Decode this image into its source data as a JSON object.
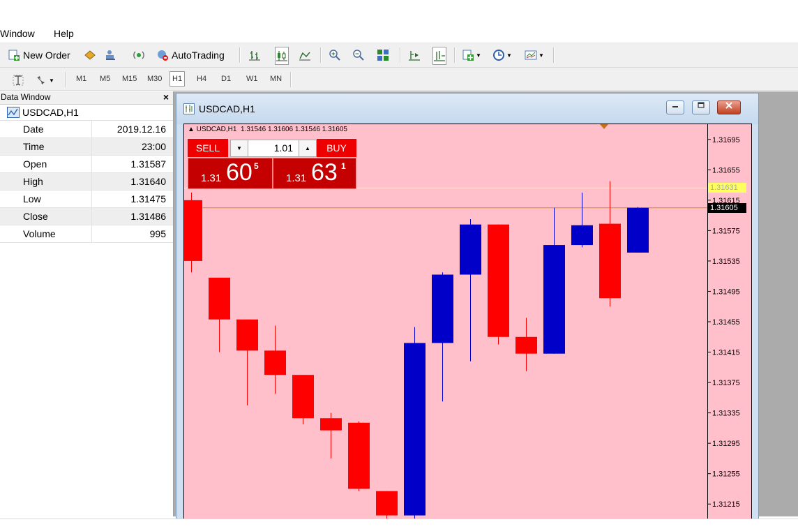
{
  "menu": [
    "Window",
    "Help"
  ],
  "toolbar": {
    "new_order": "New Order",
    "auto_trading": "AutoTrading"
  },
  "timeframes": [
    "M1",
    "M5",
    "M15",
    "M30",
    "H1",
    "H4",
    "D1",
    "W1",
    "MN"
  ],
  "active_timeframe": "H1",
  "data_window": {
    "title": "Data Window",
    "close_glyph": "×",
    "symbol": "USDCAD,H1",
    "rows": [
      {
        "key": "Date",
        "value": "2019.12.16"
      },
      {
        "key": "Time",
        "value": "23:00"
      },
      {
        "key": "Open",
        "value": "1.31587"
      },
      {
        "key": "High",
        "value": "1.31640"
      },
      {
        "key": "Low",
        "value": "1.31475"
      },
      {
        "key": "Close",
        "value": "1.31486"
      },
      {
        "key": "Volume",
        "value": "995"
      }
    ]
  },
  "chart_window": {
    "title": "USDCAD,H1",
    "info_line": "▲ USDCAD,H1  1.31546 1.31606 1.31546 1.31605",
    "sell_label": "SELL",
    "buy_label": "BUY",
    "lot_size": "1.01",
    "sell_price": {
      "prefix": "1.31",
      "big": "60",
      "sup": "5"
    },
    "buy_price": {
      "prefix": "1.31",
      "big": "63",
      "sup": "1"
    },
    "price_tag_current": "1.31605",
    "price_tag_yellow": "1.31631",
    "price_labels": [
      "1.31695",
      "1.31655",
      "1.31615",
      "1.31575",
      "1.31535",
      "1.31495",
      "1.31455",
      "1.31415",
      "1.31375",
      "1.31335",
      "1.31295",
      "1.31255",
      "1.31215"
    ]
  },
  "colors": {
    "chart_bg": "#ffc0cb",
    "bear_candle": "#ff0000",
    "bull_candle": "#0000c8",
    "ask_line": "#e08a00",
    "bid_line": "#ffff66",
    "trade_button": "#e00000"
  },
  "chart_data": {
    "type": "candlestick",
    "ylim": [
      1.31195,
      1.31715
    ],
    "candles": [
      {
        "o": 1.31615,
        "h": 1.31625,
        "l": 1.3152,
        "c": 1.31535
      },
      {
        "o": 1.31513,
        "h": 1.31513,
        "l": 1.31415,
        "c": 1.31458
      },
      {
        "o": 1.31458,
        "h": 1.31458,
        "l": 1.31345,
        "c": 1.31417
      },
      {
        "o": 1.31417,
        "h": 1.3145,
        "l": 1.3136,
        "c": 1.31385
      },
      {
        "o": 1.31385,
        "h": 1.31385,
        "l": 1.3132,
        "c": 1.31328
      },
      {
        "o": 1.31328,
        "h": 1.31335,
        "l": 1.31275,
        "c": 1.31312
      },
      {
        "o": 1.31322,
        "h": 1.31324,
        "l": 1.31232,
        "c": 1.31235
      },
      {
        "o": 1.31232,
        "h": 1.31232,
        "l": 1.31195,
        "c": 1.312
      },
      {
        "o": 1.312,
        "h": 1.31448,
        "l": 1.31195,
        "c": 1.31427
      },
      {
        "o": 1.31427,
        "h": 1.3152,
        "l": 1.3135,
        "c": 1.31517
      },
      {
        "o": 1.31517,
        "h": 1.3159,
        "l": 1.31403,
        "c": 1.31583
      },
      {
        "o": 1.31583,
        "h": 1.31583,
        "l": 1.31425,
        "c": 1.31435
      },
      {
        "o": 1.31435,
        "h": 1.3146,
        "l": 1.3139,
        "c": 1.31413
      },
      {
        "o": 1.31413,
        "h": 1.31605,
        "l": 1.31413,
        "c": 1.31556
      },
      {
        "o": 1.31556,
        "h": 1.31625,
        "l": 1.31553,
        "c": 1.31582
      },
      {
        "o": 1.31584,
        "h": 1.3164,
        "l": 1.31475,
        "c": 1.31486
      },
      {
        "o": 1.31546,
        "h": 1.31606,
        "l": 1.31546,
        "c": 1.31605
      }
    ],
    "ask": 1.31631,
    "bid": 1.31605
  }
}
